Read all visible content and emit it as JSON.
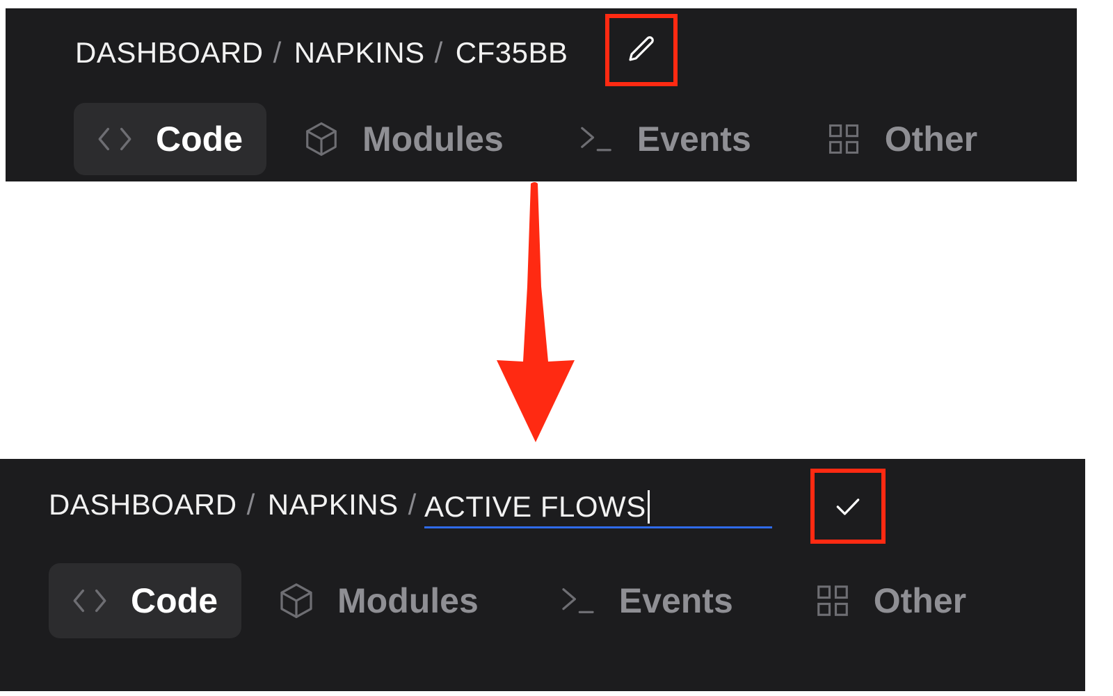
{
  "accent_color": "#2f6bea",
  "highlight_color": "#ff2a12",
  "before": {
    "breadcrumb": {
      "items": [
        "DASHBOARD",
        "NAPKINS",
        "CF35BB"
      ],
      "separator": "/"
    },
    "edit_icon": "pencil-icon",
    "tabs": [
      {
        "label": "Code",
        "icon": "code-brackets-icon",
        "active": true
      },
      {
        "label": "Modules",
        "icon": "cube-icon",
        "active": false
      },
      {
        "label": "Events",
        "icon": "terminal-icon",
        "active": false
      },
      {
        "label": "Other",
        "icon": "grid-icon",
        "active": false
      }
    ]
  },
  "after": {
    "breadcrumb": {
      "items": [
        "DASHBOARD",
        "NAPKINS"
      ],
      "separator": "/"
    },
    "title_input_value": "ACTIVE FLOWS",
    "confirm_icon": "checkmark-icon",
    "tabs": [
      {
        "label": "Code",
        "icon": "code-brackets-icon",
        "active": true
      },
      {
        "label": "Modules",
        "icon": "cube-icon",
        "active": false
      },
      {
        "label": "Events",
        "icon": "terminal-icon",
        "active": false
      },
      {
        "label": "Other",
        "icon": "grid-icon",
        "active": false
      }
    ]
  }
}
